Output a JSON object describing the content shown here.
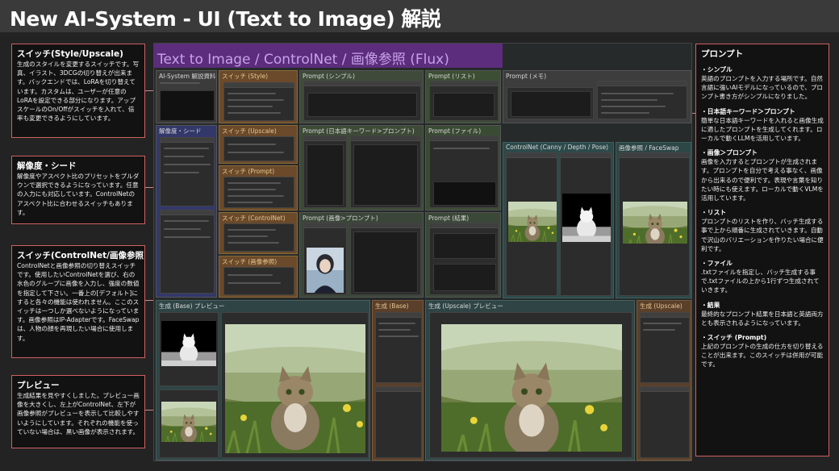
{
  "header": {
    "title": "New AI-System - UI (Text to Image) 解説"
  },
  "notes": {
    "style": {
      "heading": "スイッチ(Style/Upscale)",
      "body": "生成のスタイルを変更するスイッチです。写真、イラスト、3DCGの切り替えが出来ます。バックエンドでは、LoRAを切り替えています。カスタムは、ユーザーが任意のLoRAを設定できる部分になります。アップスケールのOn/Offがスイッチを入れて、倍率も変更できるようにしています。"
    },
    "res": {
      "heading": "解像度・シード",
      "body": "解像度やアスペクト比のプリセットをプルダウンで選択できるようになっています。任意の入力にも対応しています。ControlNetのアスペクト比に合わせるスイッチもあります。"
    },
    "cn": {
      "heading": "スイッチ(ControlNet/画像参照)",
      "body": "ControlNetと画像参照の切り替えスイッチです。使用したいControlNetを選び、右の水色のグループに画像を入力し、強度の数値を指定して下さい。一番上の[デフォルト]にすると各々の機能は使われません。ここのスイッチは一つしか選べないようになっています。画像参照はIP-Adapterです。FaceSwapは、人物の顔を再現したい場合に使用します。"
    },
    "preview": {
      "heading": "プレビュー",
      "body": "生成結果を見やすくしました。プレビュー画像を大きくし、左上がControlNet、左下が画像参照がプレビューを表示して比較しやすいようにしています。それぞれの機能を使っていない場合は、黒い画像が表示されます。"
    },
    "prompt": {
      "heading": "プロンプト",
      "sections": [
        {
          "title": "・シンプル",
          "body": "英語のプロンプトを入力する場所です。自然言語に強いAIモデルになっているので、プロンプト書き方がシンプルになりました。"
        },
        {
          "title": "・日本語キーワード＞プロンプト",
          "body": "簡単な日本語キーワードを入れると画像生成に適したプロンプトを生成してくれます。ローカルで動くLLMを活用しています。"
        },
        {
          "title": "・画像＞プロンプト",
          "body": "画像を入力するとプロンプトが生成されます。プロンプトを自分で考える事なく、画像から出来るので便利です。表現や言葉を知りたい時にも使えます。ローカルで動くVLMを活用しています。"
        },
        {
          "title": "・リスト",
          "body": "プロンプトのリストを作り、バッチ生成する事で上から順番に生成されていきます。自動で沢山のバリエーションを作りたい場合に便利です。"
        },
        {
          "title": "・ファイル",
          "body": ".txtファイルを指定し、バッチ生成する事で.txtファイルの上から1行ずつ生成されていきます。"
        },
        {
          "title": "・結果",
          "body": "最終的なプロンプト結果を日本語と英語両方とも表示されるようになっています。"
        },
        {
          "title": "・スイッチ (Prompt)",
          "body": "上記のプロンプトの生成の仕方を切り替えることが出来ます。このスイッチは併用が可能です。"
        }
      ]
    }
  },
  "workspace": {
    "banner": "Text to Image / ControlNet / 画像参照 (Flux)",
    "groups": {
      "sys": "AI-System 解説資料",
      "style": "スイッチ (Style)",
      "prompt_simple": "Prompt (シンプル)",
      "prompt_list": "Prompt (リスト)",
      "prompt_memo": "Prompt (メモ)",
      "res_seed": "解像度・シード",
      "upscale_sw": "スイッチ (Upscale)",
      "prompt_jp": "Prompt (日本語キーワード>プロンプト)",
      "prompt_file": "Prompt (ファイル)",
      "controlnet": "ControlNet (Canny / Depth / Pose)",
      "image_ref": "画像参照 / FaceSwap",
      "prompt_sw": "スイッチ (Prompt)",
      "cn_sw": "スイッチ (ControlNet)",
      "prompt_img": "Prompt (画像>プロンプト)",
      "prompt_result": "Prompt (結果)",
      "ref_sw": "スイッチ (画像参照)",
      "preview": "生成 (Base) プレビュー",
      "base": "生成 (Base)",
      "upscale_preview": "生成 (Upscale) プレビュー",
      "upscale": "生成 (Upscale)"
    }
  },
  "icons": {
    "cat_image": "cat-in-meadow-image",
    "depth_image": "depth-map-image",
    "portrait_image": "portrait-woman-image"
  },
  "colors": {
    "annotation_border": "#d06060",
    "banner": "#5b2d7c",
    "switch_group": "#6a4a2a",
    "controlnet_group": "#2d4a4a"
  }
}
